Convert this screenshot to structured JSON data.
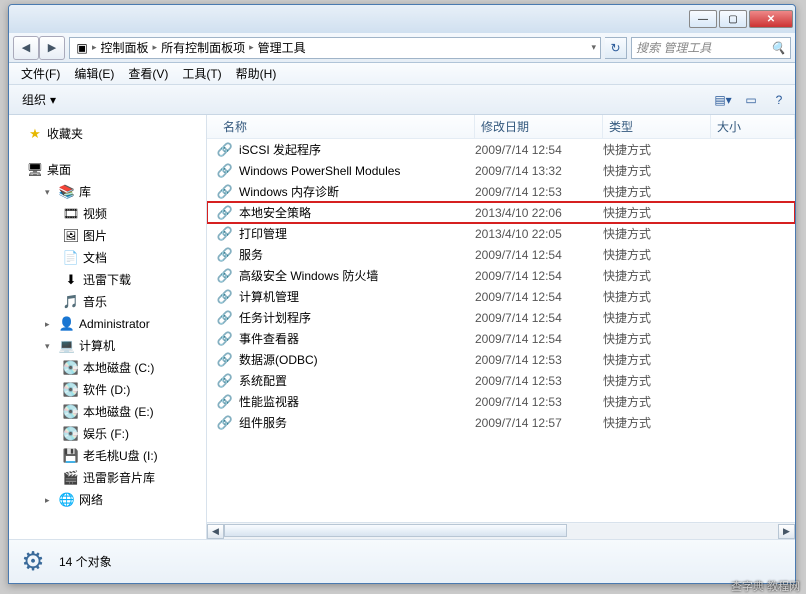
{
  "titlebar": {
    "min": "—",
    "max": "▢",
    "close": "✕"
  },
  "breadcrumb": {
    "items": [
      "控制面板",
      "所有控制面板项",
      "管理工具"
    ],
    "sep": "▸",
    "refresh": "↻"
  },
  "search": {
    "placeholder": "搜索 管理工具",
    "icon": "🔍"
  },
  "menu": {
    "file": "文件(F)",
    "edit": "编辑(E)",
    "view": "查看(V)",
    "tools": "工具(T)",
    "help": "帮助(H)"
  },
  "toolbar": {
    "organize": "组织",
    "drop": "▾",
    "views": "▤▾",
    "preview": "▭",
    "help": "?"
  },
  "nav": {
    "fav": {
      "label": "收藏夹",
      "icon": "★"
    },
    "desktop": {
      "label": "桌面",
      "icon": "🖥"
    },
    "lib": {
      "label": "库",
      "icon": "📚",
      "items": [
        {
          "label": "视频",
          "icon": "🎞"
        },
        {
          "label": "图片",
          "icon": "🖼"
        },
        {
          "label": "文档",
          "icon": "📄"
        },
        {
          "label": "迅雷下载",
          "icon": "⬇"
        },
        {
          "label": "音乐",
          "icon": "🎵"
        }
      ]
    },
    "admin": {
      "label": "Administrator",
      "icon": "👤"
    },
    "computer": {
      "label": "计算机",
      "icon": "💻",
      "drives": [
        {
          "label": "本地磁盘 (C:)",
          "icon": "💽"
        },
        {
          "label": "软件 (D:)",
          "icon": "💽"
        },
        {
          "label": "本地磁盘 (E:)",
          "icon": "💽"
        },
        {
          "label": "娱乐 (F:)",
          "icon": "💽"
        },
        {
          "label": "老毛桃U盘 (I:)",
          "icon": "💾"
        },
        {
          "label": "迅雷影音片库",
          "icon": "🎬"
        }
      ]
    },
    "network": {
      "label": "网络",
      "icon": "🌐"
    }
  },
  "columns": {
    "name": "名称",
    "date": "修改日期",
    "type": "类型",
    "size": "大小"
  },
  "items": [
    {
      "name": "iSCSI 发起程序",
      "date": "2009/7/14 12:54",
      "type": "快捷方式",
      "hl": false
    },
    {
      "name": "Windows PowerShell Modules",
      "date": "2009/7/14 13:32",
      "type": "快捷方式",
      "hl": false
    },
    {
      "name": "Windows 内存诊断",
      "date": "2009/7/14 12:53",
      "type": "快捷方式",
      "hl": false
    },
    {
      "name": "本地安全策略",
      "date": "2013/4/10 22:06",
      "type": "快捷方式",
      "hl": true
    },
    {
      "name": "打印管理",
      "date": "2013/4/10 22:05",
      "type": "快捷方式",
      "hl": false
    },
    {
      "name": "服务",
      "date": "2009/7/14 12:54",
      "type": "快捷方式",
      "hl": false
    },
    {
      "name": "高级安全 Windows 防火墙",
      "date": "2009/7/14 12:54",
      "type": "快捷方式",
      "hl": false
    },
    {
      "name": "计算机管理",
      "date": "2009/7/14 12:54",
      "type": "快捷方式",
      "hl": false
    },
    {
      "name": "任务计划程序",
      "date": "2009/7/14 12:54",
      "type": "快捷方式",
      "hl": false
    },
    {
      "name": "事件查看器",
      "date": "2009/7/14 12:54",
      "type": "快捷方式",
      "hl": false
    },
    {
      "name": "数据源(ODBC)",
      "date": "2009/7/14 12:53",
      "type": "快捷方式",
      "hl": false
    },
    {
      "name": "系统配置",
      "date": "2009/7/14 12:53",
      "type": "快捷方式",
      "hl": false
    },
    {
      "name": "性能监视器",
      "date": "2009/7/14 12:53",
      "type": "快捷方式",
      "hl": false
    },
    {
      "name": "组件服务",
      "date": "2009/7/14 12:57",
      "type": "快捷方式",
      "hl": false
    }
  ],
  "status": {
    "count": "14 个对象",
    "icon": "⚙"
  },
  "watermark": "查字典 教程网"
}
